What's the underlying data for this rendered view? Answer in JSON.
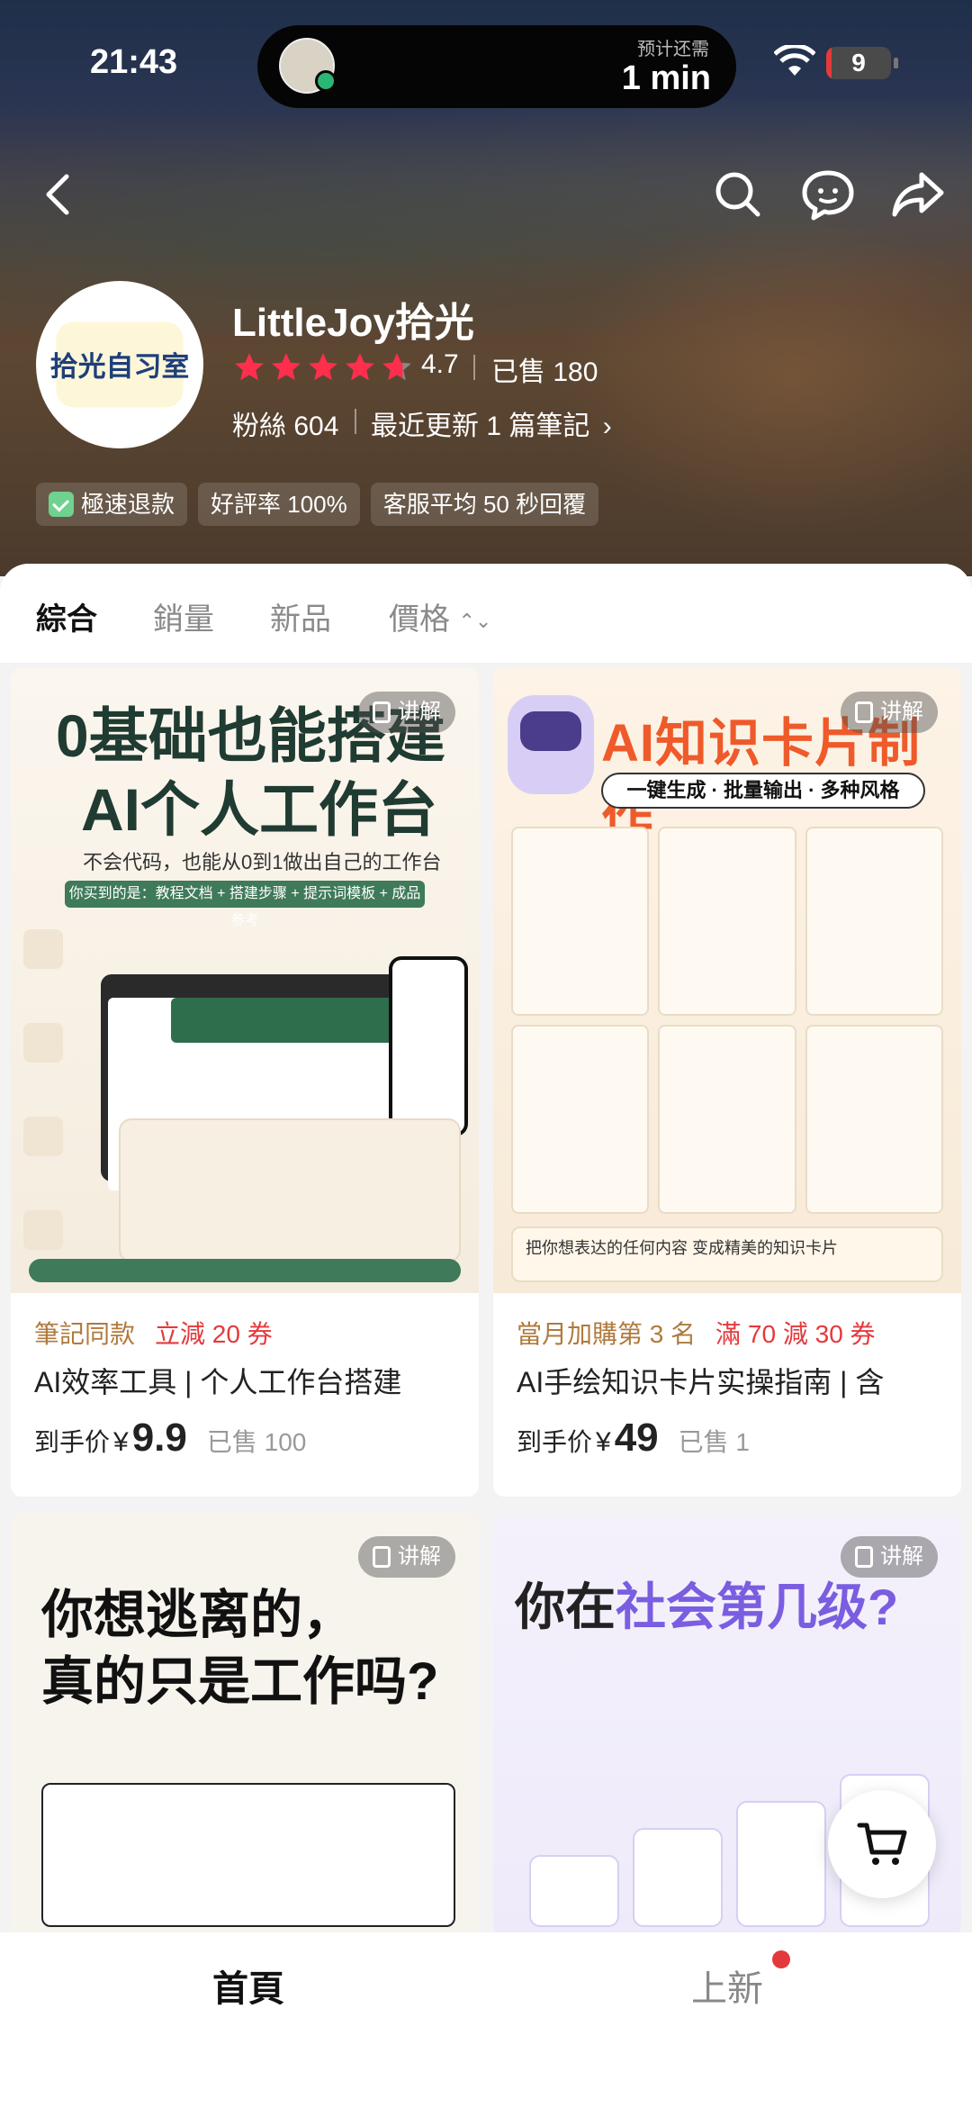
{
  "status_bar": {
    "time": "21:43",
    "island_label": "预计还需",
    "island_value": "1 min",
    "battery": "9",
    "battery_level": 0.09
  },
  "nav_icons": [
    "back-icon",
    "search-icon",
    "chat-icon",
    "share-icon"
  ],
  "shop": {
    "name": "LittleJoy拾光",
    "logo_text": "拾光自习室",
    "rating": "4.7",
    "rating_stars": 4.7,
    "sold": "已售 180",
    "fans": "粉絲 604",
    "recent": "最近更新 1 篇筆記",
    "tags": [
      "極速退款",
      "好評率 100%",
      "客服平均 50 秒回覆"
    ]
  },
  "sort_tabs": [
    "綜合",
    "銷量",
    "新品",
    "價格"
  ],
  "products": [
    {
      "explain": "讲解",
      "tag_a": "筆記同款",
      "tag_b": "立減 20 券",
      "title": "AI效率工具 | 个人工作台搭建",
      "price_pre": "到手价",
      "currency": "¥",
      "price": "9.9",
      "sold": "已售 100",
      "cover": {
        "h1": "0基础也能搭建",
        "h2": "AI个人工作台",
        "sub": "不会代码，也能从0到1做出自己的工作台",
        "bar": "你买到的是：教程文档 + 搭建步骤 + 提示词模板 + 成品参考"
      }
    },
    {
      "explain": "讲解",
      "tag_a": "當月加購第 3 名",
      "tag_b": "滿 70 減 30 券",
      "title": "AI手绘知识卡片实操指南 | 含",
      "price_pre": "到手价",
      "currency": "¥",
      "price": "49",
      "sold": "已售 1",
      "cover": {
        "h1": "AI知识卡片制作",
        "pill": "一键生成 · 批量输出 · 多种风格",
        "bottom": "把你想表达的任何内容 变成精美的知识卡片"
      }
    },
    {
      "explain": "讲解",
      "cover": {
        "h1": "你想逃离的，",
        "h2": "真的只是工作吗?"
      }
    },
    {
      "explain": "讲解",
      "cover": {
        "h1a": "你在",
        "h1b": "社会第几级?"
      }
    }
  ],
  "bottom_nav": [
    "首頁",
    "上新"
  ],
  "colors": {
    "accent_red": "#e4393c",
    "tag_gold": "#b07a3d",
    "green_dark": "#1f3b32",
    "orange": "#ef5a2a",
    "purple": "#7a5de0"
  }
}
